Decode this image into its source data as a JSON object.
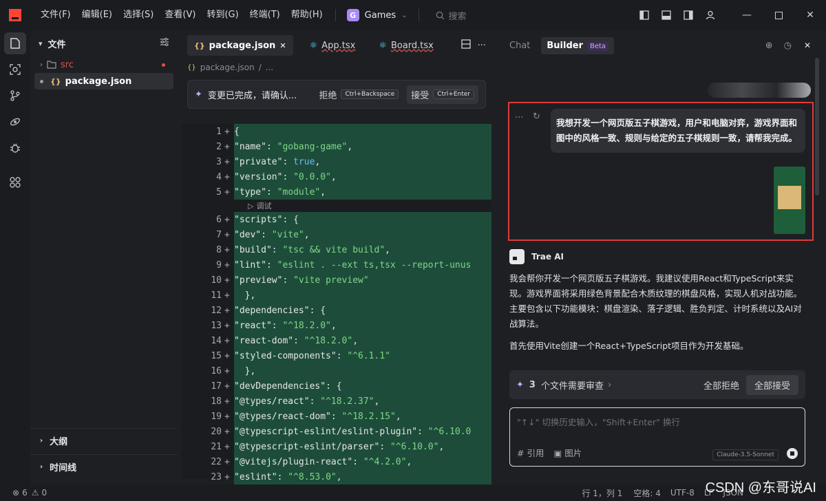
{
  "menu": [
    "文件(F)",
    "编辑(E)",
    "选择(S)",
    "查看(V)",
    "转到(G)",
    "终端(T)",
    "帮助(H)"
  ],
  "project": {
    "badge": "G",
    "name": "Games"
  },
  "search_placeholder": "搜索",
  "explorer": {
    "title": "文件",
    "items": [
      {
        "name": "src",
        "type": "folder"
      },
      {
        "name": "package.json",
        "type": "file"
      }
    ],
    "outline": "大纲",
    "timeline": "时间线"
  },
  "editor": {
    "tabs": [
      "package.json",
      "App.tsx",
      "Board.tsx"
    ],
    "breadcrumb": [
      "package.json",
      "..."
    ],
    "review_text": "变更已完成，请确认...",
    "reject_label": "拒绝",
    "reject_key": "Ctrl+Backspace",
    "accept_label": "接受",
    "accept_key": "Ctrl+Enter",
    "debug_label": "调试",
    "lines": [
      {
        "n": "1",
        "t": "{"
      },
      {
        "n": "2",
        "t": "  \"name\": \"gobang-game\","
      },
      {
        "n": "3",
        "t": "  \"private\": true,"
      },
      {
        "n": "4",
        "t": "  \"version\": \"0.0.0\","
      },
      {
        "n": "5",
        "t": "  \"type\": \"module\","
      },
      {
        "n": "6",
        "t": "  \"scripts\": {"
      },
      {
        "n": "7",
        "t": "    \"dev\": \"vite\","
      },
      {
        "n": "8",
        "t": "    \"build\": \"tsc && vite build\","
      },
      {
        "n": "9",
        "t": "    \"lint\": \"eslint . --ext ts,tsx --report-unus"
      },
      {
        "n": "10",
        "t": "    \"preview\": \"vite preview\""
      },
      {
        "n": "11",
        "t": "  },"
      },
      {
        "n": "12",
        "t": "  \"dependencies\": {"
      },
      {
        "n": "13",
        "t": "    \"react\": \"^18.2.0\","
      },
      {
        "n": "14",
        "t": "    \"react-dom\": \"^18.2.0\","
      },
      {
        "n": "15",
        "t": "    \"styled-components\": \"^6.1.1\""
      },
      {
        "n": "16",
        "t": "  },"
      },
      {
        "n": "17",
        "t": "  \"devDependencies\": {"
      },
      {
        "n": "18",
        "t": "    \"@types/react\": \"^18.2.37\","
      },
      {
        "n": "19",
        "t": "    \"@types/react-dom\": \"^18.2.15\","
      },
      {
        "n": "20",
        "t": "    \"@typescript-eslint/eslint-plugin\": \"^6.10.0"
      },
      {
        "n": "21",
        "t": "    \"@typescript-eslint/parser\": \"^6.10.0\","
      },
      {
        "n": "22",
        "t": "    \"@vitejs/plugin-react\": \"^4.2.0\","
      },
      {
        "n": "23",
        "t": "    \"eslint\": \"^8.53.0\","
      }
    ]
  },
  "chat": {
    "tab_chat": "Chat",
    "tab_builder": "Builder",
    "beta": "Beta",
    "user_message": "我想开发一个网页版五子棋游戏，用户和电脑对弈，游戏界面和图中的风格一致、规则与给定的五子棋规则一致，请帮我完成。",
    "ai_name": "Trae AI",
    "ai_paragraph1": "我会帮你开发一个网页版五子棋游戏。我建议使用React和TypeScript来实现。游戏界面将采用绿色背景配合木质纹理的棋盘风格，实现人机对战功能。主要包含以下功能模块：棋盘渲染、落子逻辑、胜负判定、计时系统以及AI对战算法。",
    "ai_paragraph2": "首先使用Vite创建一个React+TypeScript项目作为开发基础。",
    "files_count": "3",
    "files_text": "个文件需要审查",
    "reject_all": "全部拒绝",
    "accept_all": "全部接受",
    "input_placeholder": "\"↑↓\" 切换历史输入，\"Shift+Enter\" 换行",
    "ref_label": "# 引用",
    "image_label": "图片",
    "model": "Claude-3.5-Sonnet"
  },
  "status": {
    "errors": "6",
    "warnings": "0",
    "position": "行 1，列 1",
    "spaces": "空格: 4",
    "encoding": "UTF-8",
    "eol": "LF",
    "lang": "JSON"
  },
  "watermark": "CSDN @东哥说AI"
}
